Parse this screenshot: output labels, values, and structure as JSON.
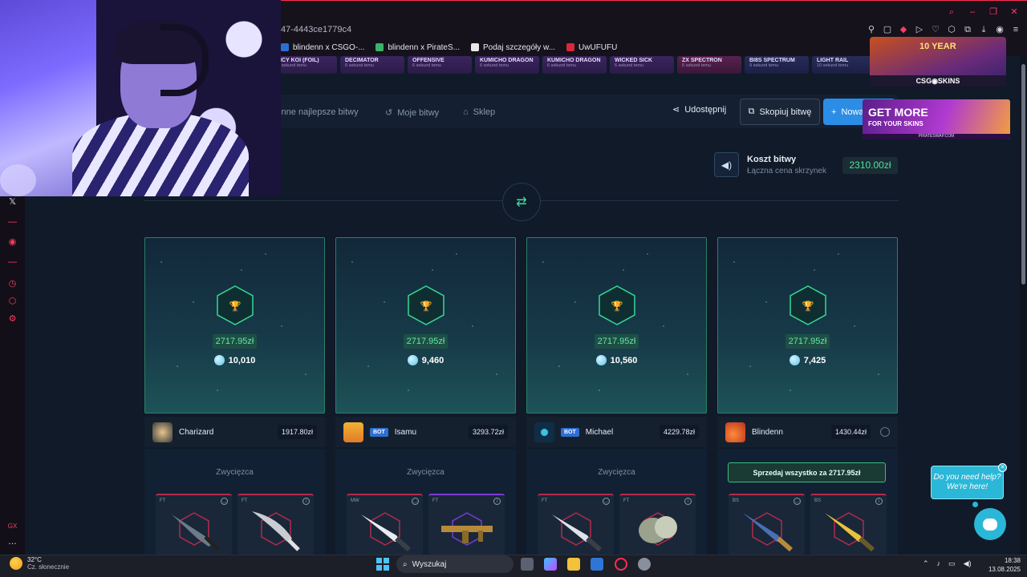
{
  "browser": {
    "url_fragment": "47-4443ce1779c4",
    "bookmarks": [
      {
        "label": "blindenn x CSGO-...",
        "color": "#2a6fd6"
      },
      {
        "label": "blindenn x PirateS...",
        "color": "#3bb36a"
      },
      {
        "label": "Podaj szczegóły w...",
        "color": "#e8e8e8"
      },
      {
        "label": "UwUFUFU",
        "color": "#d8283a"
      }
    ]
  },
  "ribbon": [
    {
      "name": "NCY KOI (FOIL)",
      "sub": "6 sekund temu"
    },
    {
      "name": "DECIMATOR",
      "sub": "6 sekund temu"
    },
    {
      "name": "OFFENSIVE",
      "sub": "6 sekund temu"
    },
    {
      "name": "KUMICHO DRAGON",
      "sub": "6 sekund temu"
    },
    {
      "name": "KUMICHO DRAGON",
      "sub": "6 sekund temu"
    },
    {
      "name": "WICKED SICK",
      "sub": "6 sekund temu"
    },
    {
      "name": "ZX SPECTRON",
      "sub": "6 sekund temu"
    },
    {
      "name": "BI8S SPECTRUM",
      "sub": "9 sekund temu"
    },
    {
      "name": "LIGHT RAIL",
      "sub": "10 sekund temu"
    }
  ],
  "nav": {
    "items": [
      "ienne najlepsze bitwy",
      "Moje bitwy",
      "Sklep"
    ],
    "share": "Udostępnij",
    "copy": "Skopiuj bitwę",
    "new": "Nowa"
  },
  "ads": {
    "ad1_title": "10 YEAR",
    "ad1_label": "CSG◉SKINS",
    "ad2_line1": "GET MORE",
    "ad2_line2": "FOR YOUR SKINS",
    "ad2_line3": "PIRATESWAP.COM"
  },
  "cost": {
    "title": "Koszt bitwy",
    "subtitle": "Łączna cena skrzynek",
    "value": "2310.00zł"
  },
  "players": [
    {
      "prize": "2717.95zł",
      "points": "10,010",
      "name": "Charizard",
      "bot": "",
      "value": "1917.80zł",
      "status": "Zwycięzca",
      "items": [
        {
          "cond": "FT"
        },
        {
          "cond": "FT"
        }
      ]
    },
    {
      "prize": "2717.95zł",
      "points": "9,460",
      "name": "Isamu",
      "bot": "BOT",
      "value": "3293.72zł",
      "status": "Zwycięzca",
      "items": [
        {
          "cond": "MW"
        },
        {
          "cond": "FT"
        }
      ]
    },
    {
      "prize": "2717.95zł",
      "points": "10,560",
      "name": "Michael",
      "bot": "BOT",
      "value": "4229.78zł",
      "status": "Zwycięzca",
      "items": [
        {
          "cond": "FT"
        },
        {
          "cond": "FT"
        }
      ]
    },
    {
      "prize": "2717.95zł",
      "points": "7,425",
      "name": "Blindenn",
      "bot": "",
      "value": "1430.44zł",
      "sell": "Sprzedaj wszystko za 2717.95zł",
      "items": [
        {
          "cond": "BS"
        },
        {
          "cond": "BS"
        }
      ]
    }
  ],
  "help": {
    "text": "Do you need help? We're here!"
  },
  "taskbar": {
    "temp": "32°C",
    "weather": "Cz. słonecznie",
    "search": "Wyszukaj",
    "time": "18:38",
    "date": "13.08.2025"
  },
  "colors": {
    "accent_green": "#4fe3a0",
    "primary_blue": "#2b8de6",
    "card_border": "#2a8067",
    "opera_red": "#ff2d55"
  }
}
